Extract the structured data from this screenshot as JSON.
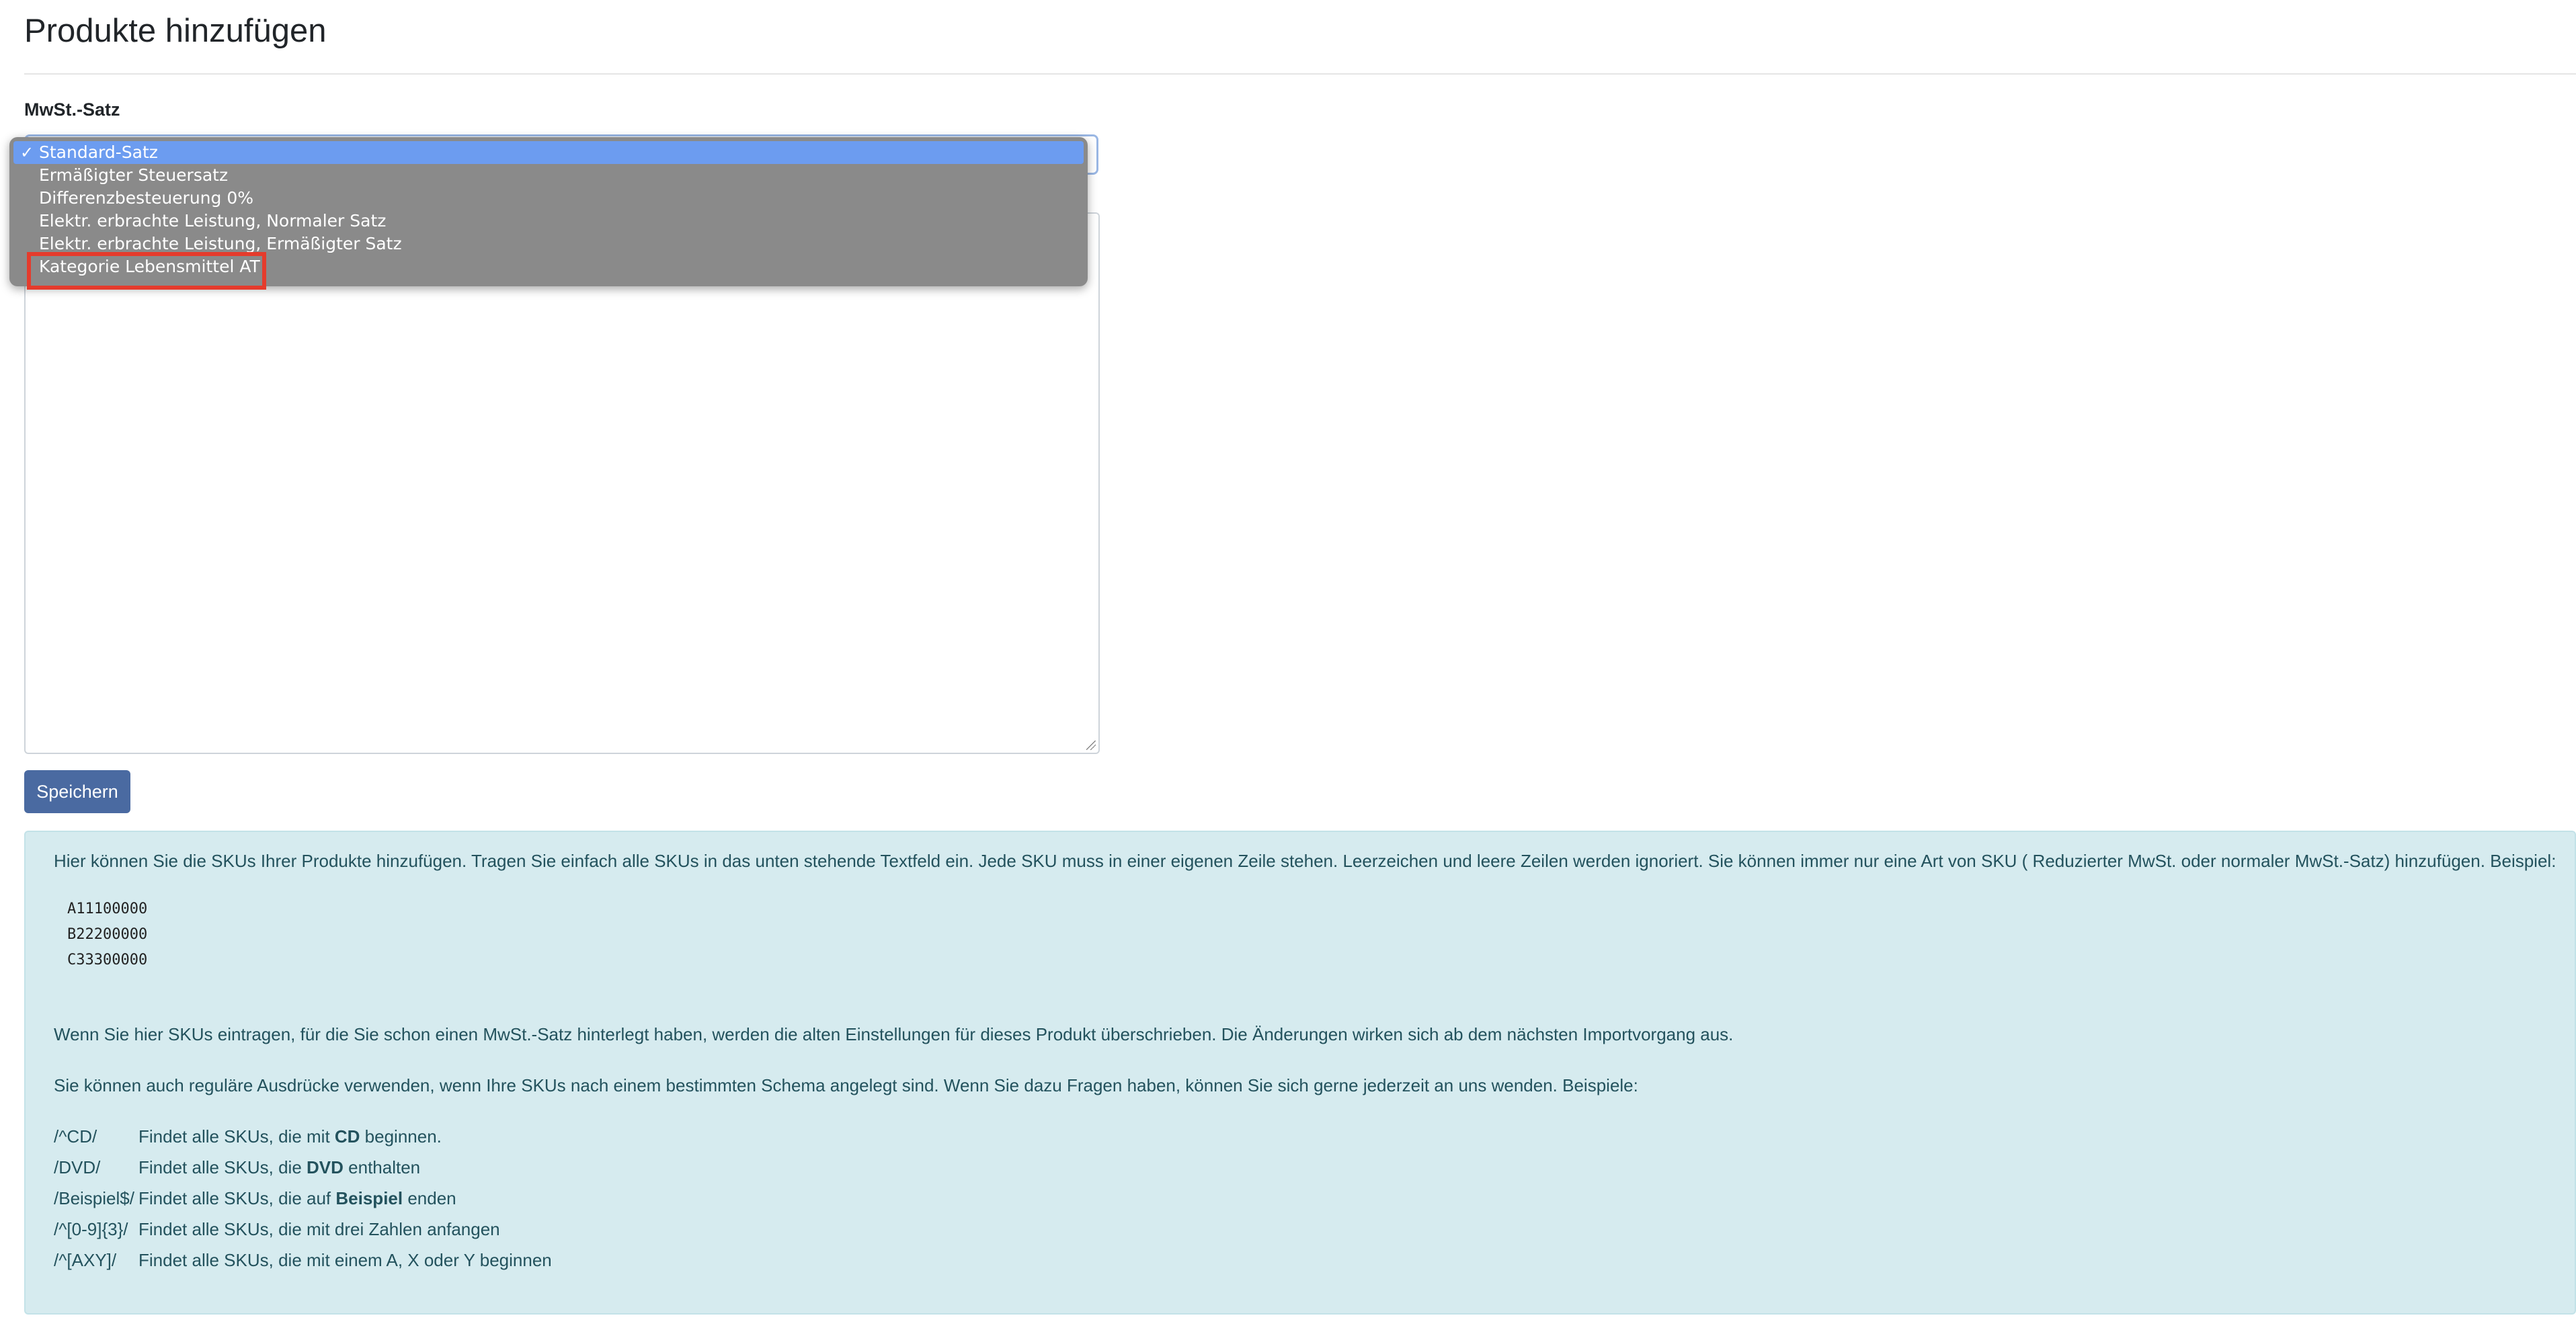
{
  "page": {
    "title": "Produkte hinzufügen"
  },
  "form": {
    "vat_label": "MwSt.-Satz",
    "save_label": "Speichern"
  },
  "vat_select": {
    "selected": "Standard-Satz",
    "options": [
      "Standard-Satz",
      "Ermäßigter Steuersatz",
      "Differenzbesteuerung 0%",
      "Elektr. erbrachte Leistung, Normaler Satz",
      "Elektr. erbrachte Leistung, Ermäßigter Satz",
      "Kategorie Lebensmittel AT"
    ],
    "highlighted_option": "Kategorie Lebensmittel AT"
  },
  "info": {
    "intro": "Hier können Sie die SKUs Ihrer Produkte hinzufügen. Tragen Sie einfach alle SKUs in das unten stehende Textfeld ein. Jede SKU muss in einer eigenen Zeile stehen. Leerzeichen und leere Zeilen werden ignoriert. Sie können immer nur eine Art von SKU ( Reduzierter MwSt. oder normaler MwSt.-Satz) hinzufügen. Beispiel:",
    "sku_examples": [
      "A11100000",
      "B22200000",
      "C33300000"
    ],
    "overwrite_note": "Wenn Sie hier SKUs eintragen, für die Sie schon einen MwSt.-Satz hinterlegt haben, werden die alten Einstellungen für dieses Produkt überschrieben. Die Änderungen wirken sich ab dem nächsten Importvorgang aus.",
    "regex_note": "Sie können auch reguläre Ausdrücke verwenden, wenn Ihre SKUs nach einem bestimmten Schema angelegt sind. Wenn Sie dazu Fragen haben, können Sie sich gerne jederzeit an uns wenden. Beispiele:",
    "regex_examples": [
      {
        "pattern": "/^CD/",
        "pre": "Findet alle SKUs, die mit ",
        "bold": "CD",
        "post": " beginnen."
      },
      {
        "pattern": "/DVD/",
        "pre": "Findet alle SKUs, die ",
        "bold": "DVD",
        "post": " enthalten"
      },
      {
        "pattern": "/Beispiel$/",
        "pre": "Findet alle SKUs, die auf ",
        "bold": "Beispiel",
        "post": " enden"
      },
      {
        "pattern": "/^[0-9]{3}/",
        "pre": "Findet alle SKUs, die mit drei Zahlen anfangen",
        "bold": "",
        "post": ""
      },
      {
        "pattern": "/^[AXY]/",
        "pre": "Findet alle SKUs, die mit einem A, X oder Y beginnen",
        "bold": "",
        "post": ""
      }
    ]
  },
  "icons": {
    "check": "checkmark-icon",
    "select_arrows": "up-down-arrows-icon",
    "resize": "resize-grip-icon"
  },
  "colors": {
    "accent_button": "#4a6aa1",
    "dropdown_bg": "#8a8a8a",
    "dropdown_selected": "#6c9cf0",
    "info_bg": "#d6ebef",
    "info_text": "#23525d",
    "annotation_red": "#e53b2c"
  }
}
